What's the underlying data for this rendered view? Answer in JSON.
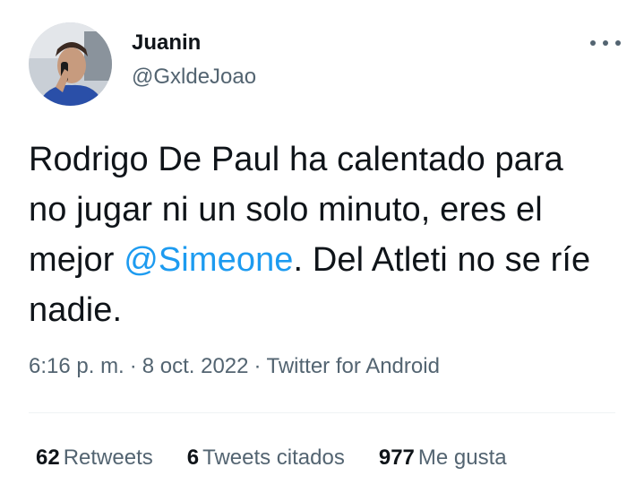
{
  "user": {
    "display_name": "Juanin",
    "handle": "@GxldeJoao"
  },
  "tweet": {
    "text_before": "Rodrigo De Paul ha calentado para no jugar ni un solo minuto, eres el mejor ",
    "mention": "@Simeone",
    "text_after": ". Del Atleti no se ríe nadie.",
    "time": "6:16 p. m.",
    "separator": "·",
    "date": "8 oct. 2022",
    "source": "Twitter for Android"
  },
  "stats": {
    "retweets_count": "62",
    "retweets_label": "Retweets",
    "quotes_count": "6",
    "quotes_label": "Tweets citados",
    "likes_count": "977",
    "likes_label": "Me gusta"
  },
  "colors": {
    "accent": "#1d9bf0",
    "text_primary": "#0f1419",
    "text_secondary": "#536471"
  },
  "icons": {
    "more": "more-horizontal-icon"
  }
}
